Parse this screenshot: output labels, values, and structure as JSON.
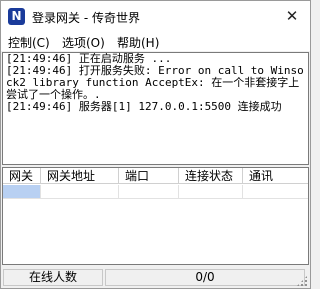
{
  "window": {
    "title": "登录网关 - 传奇世界",
    "close_symbol": "✕",
    "icon_letter": "N"
  },
  "menu": {
    "items": [
      {
        "label": "控制(C)"
      },
      {
        "label": "选项(O)"
      },
      {
        "label": "帮助(H)"
      }
    ]
  },
  "log": {
    "lines": [
      "[21:49:46] 正在启动服务 ...",
      "[21:49:46] 打开服务失败: Error on call to Winsock2 library function AcceptEx: 在一个非套接字上尝试了一个操作。.",
      "[21:49:46] 服务器[1] 127.0.0.1:5500 连接成功"
    ]
  },
  "table": {
    "columns": [
      "网关",
      "网关地址",
      "端口",
      "连接状态",
      "通讯"
    ]
  },
  "status": {
    "online_label": "在线人数",
    "online_count": "0/0"
  }
}
